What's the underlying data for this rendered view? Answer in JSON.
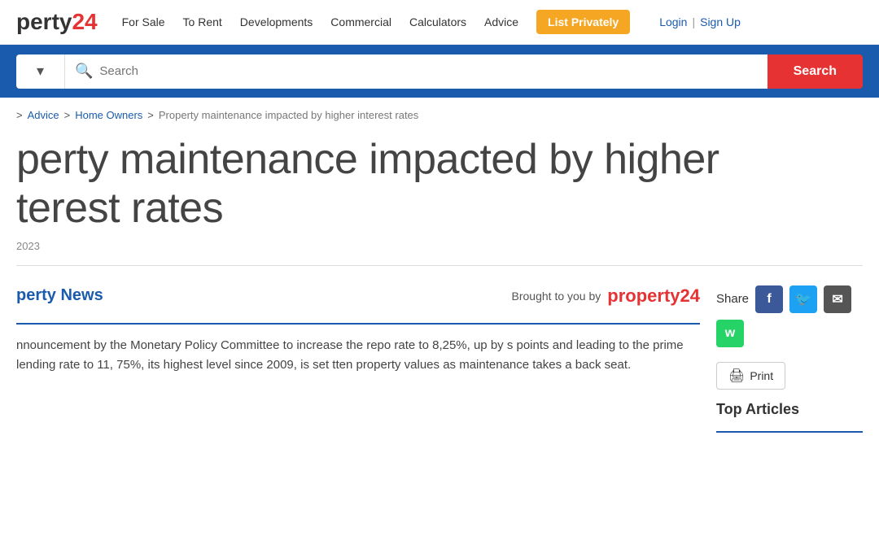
{
  "header": {
    "logo_text": "perty",
    "logo_number": "24",
    "nav_items": [
      "For Sale",
      "To Rent",
      "Developments",
      "Commercial",
      "Calculators",
      "Advice"
    ],
    "btn_list_privately": "List Privately",
    "login_label": "Login",
    "signup_label": "Sign Up"
  },
  "search_bar": {
    "placeholder": "Search",
    "button_label": "Search",
    "dropdown_icon": "▾"
  },
  "breadcrumb": {
    "items": [
      {
        "label": ">",
        "type": "sep"
      },
      {
        "label": "Advice",
        "type": "link"
      },
      {
        "label": ">",
        "type": "sep"
      },
      {
        "label": "Home Owners",
        "type": "link"
      },
      {
        "label": ">",
        "type": "sep"
      },
      {
        "label": "Property maintenance impacted by higher interest rates",
        "type": "current"
      }
    ]
  },
  "article": {
    "title": "Property maintenance impacted by higher interest rates",
    "title_display": "perty maintenance impacted by higher\nterest rates",
    "date": "2023",
    "section_label": "perty News",
    "brought_by_text": "Brought to you by",
    "brought_by_logo": "property",
    "brought_by_logo_number": "24",
    "body": "nnouncement by the Monetary Policy Committee to increase the repo rate to 8,25%, up by s points and leading to the prime lending rate to 11, 75%, its highest level since 2009, is set tten property values as maintenance takes a back seat."
  },
  "share": {
    "label": "Share",
    "icons": [
      {
        "name": "facebook",
        "symbol": "f",
        "bg": "#3b5998"
      },
      {
        "name": "twitter",
        "symbol": "t",
        "bg": "#1da1f2"
      },
      {
        "name": "email",
        "symbol": "✉",
        "bg": "#555"
      },
      {
        "name": "whatsapp",
        "symbol": "w",
        "bg": "#25d366"
      }
    ],
    "print_label": "Print"
  },
  "sidebar": {
    "top_articles_label": "Top Articles"
  },
  "colors": {
    "brand_blue": "#1a5bae",
    "brand_red": "#e63232",
    "orange": "#f5a623"
  }
}
